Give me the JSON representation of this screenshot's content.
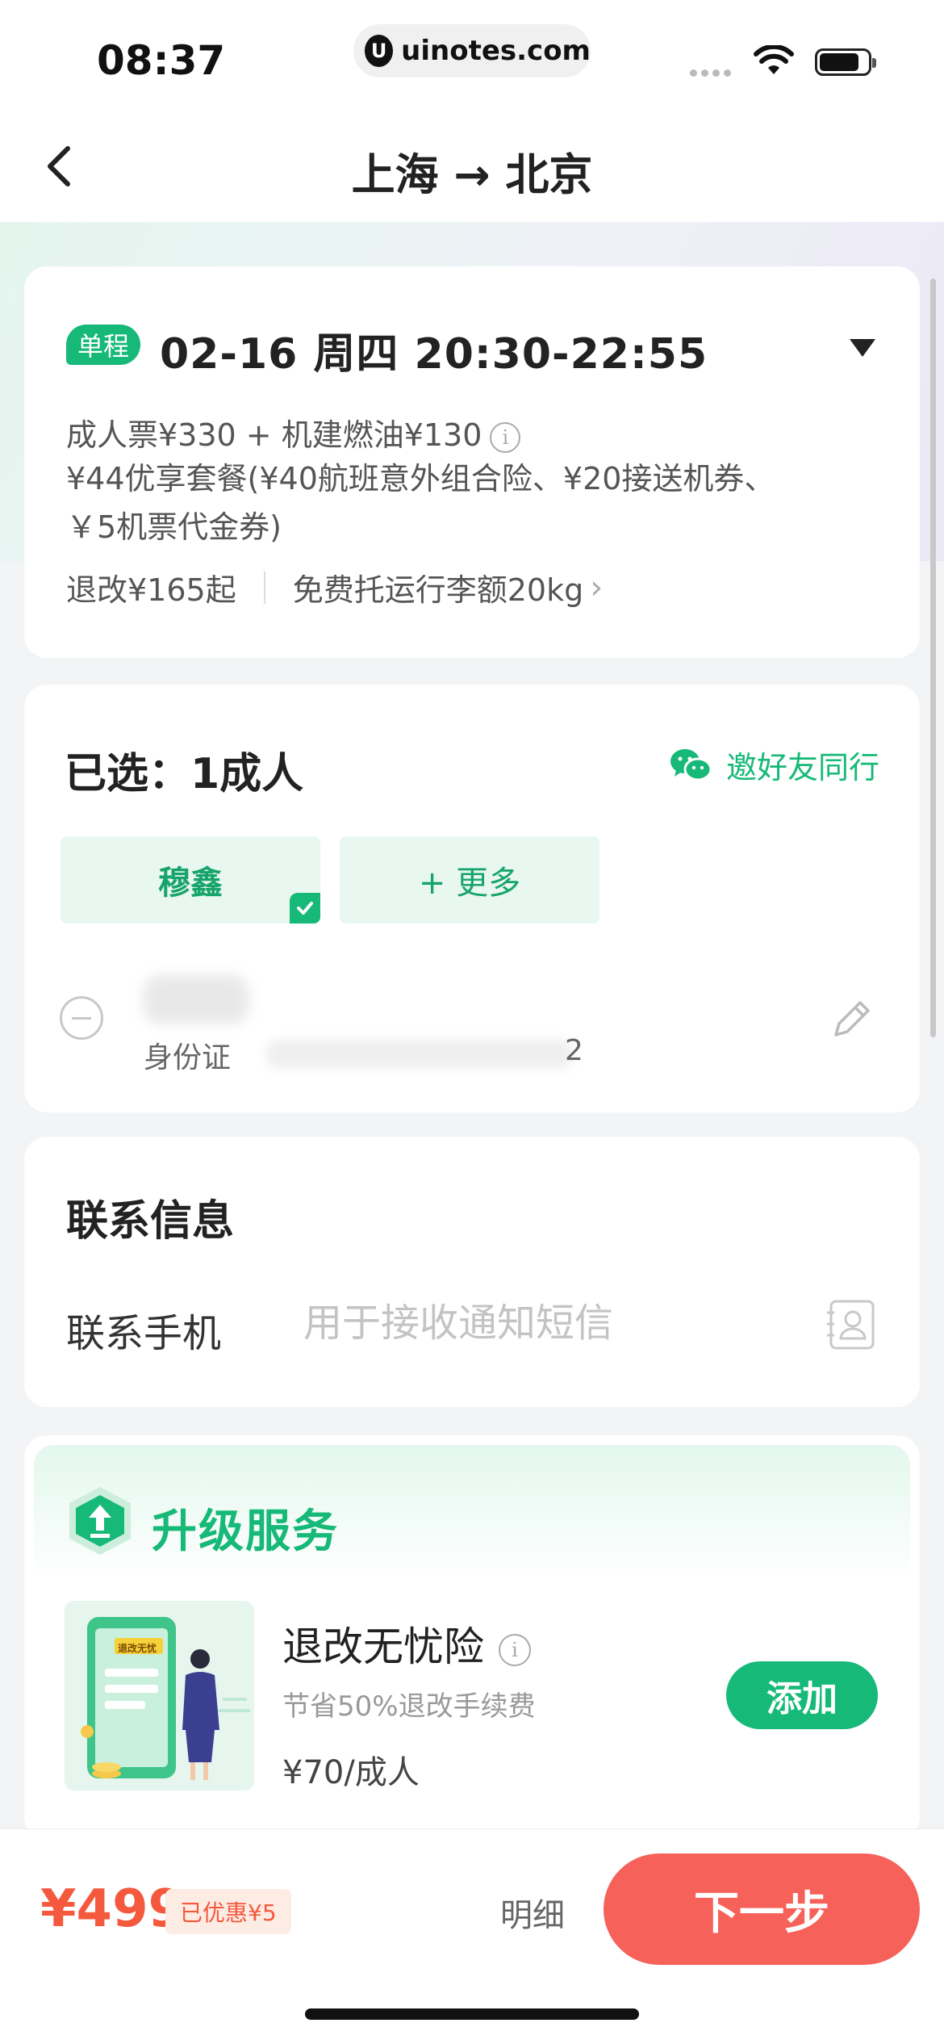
{
  "status_bar": {
    "time": "08:37",
    "url": "uinotes.com",
    "url_logo": "U"
  },
  "nav": {
    "route": "上海 → 北京"
  },
  "flight": {
    "tag": "单程",
    "date_time": "02-16 周四 20:30-22:55",
    "price_line1": "成人票¥330 + 机建燃油¥130",
    "price_line2": "¥44优享套餐(¥40航班意外组合险、¥20接送机券、",
    "price_line3": "￥5机票代金券)",
    "refund": "退改¥165起",
    "baggage": "免费托运行李额20kg"
  },
  "passengers": {
    "selected": "已选：1成人",
    "invite": "邀好友同行",
    "chips": [
      "穆鑫",
      "+ 更多"
    ],
    "id_type": "身份证",
    "id_tail": "2"
  },
  "contact": {
    "title": "联系信息",
    "phone_label": "联系手机",
    "phone_placeholder": "用于接收通知短信",
    "phone_value": ""
  },
  "upgrade": {
    "title": "升级服务",
    "image_label": "退改无忧",
    "item_name": "退改无忧险",
    "item_sub": "节省50%退改手续费",
    "item_price": "¥70/成人",
    "add_label": "添加"
  },
  "footer": {
    "total": "¥499",
    "discount": "已优惠¥5",
    "detail": "明细",
    "next": "下一步"
  },
  "colors": {
    "brand_green": "#16b978",
    "accent_red": "#f6615a",
    "price_red": "#f4593e"
  }
}
